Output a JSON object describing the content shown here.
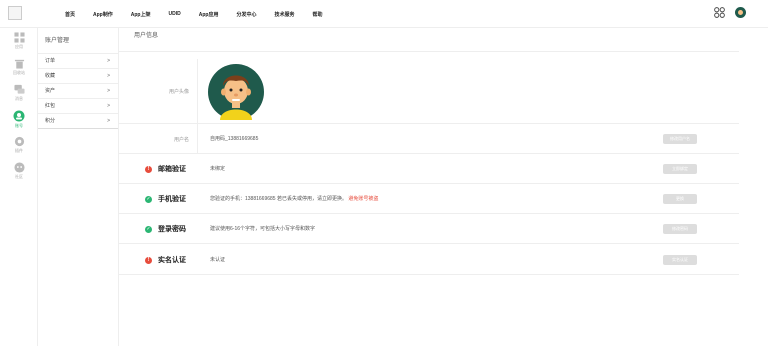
{
  "nav": {
    "items": [
      "首页",
      "App制作",
      "App上架",
      "UDID",
      "App应用",
      "分发中心",
      "技术服务",
      "帮助"
    ]
  },
  "rail": {
    "items": [
      {
        "label": "应用",
        "icon": "grid-icon"
      },
      {
        "label": "回收站",
        "icon": "trash-icon"
      },
      {
        "label": "消息",
        "icon": "message-icon"
      },
      {
        "label": "账号",
        "icon": "user-icon"
      },
      {
        "label": "插件",
        "icon": "settings-icon"
      },
      {
        "label": "社区",
        "icon": "community-icon"
      }
    ]
  },
  "menu": {
    "title": "账户管理",
    "items": [
      "订单",
      "收藏",
      "资产",
      "红包",
      "积分"
    ],
    "chevron": ">"
  },
  "main": {
    "title": "用户信息",
    "rows": {
      "avatar": {
        "label": "用户头像"
      },
      "username": {
        "label": "用户名",
        "value": "自用码_13881669685",
        "button": "修改用户名"
      },
      "email": {
        "label": "邮箱验证",
        "value": "未绑定",
        "button": "立即绑定",
        "status": "warn"
      },
      "phone": {
        "label": "手机验证",
        "value": "您验证的手机：13881669685 若已丢失或停用，请立即更换。",
        "link": "避免账号被盗",
        "button": "更换",
        "status": "ok"
      },
      "password": {
        "label": "登录密码",
        "value": "建议使用6-16个字符，可包括大小写字母和数字",
        "button": "修改密码",
        "status": "ok"
      },
      "realname": {
        "label": "实名认证",
        "value": "未认证",
        "button": "实名认证",
        "status": "warn"
      }
    }
  },
  "colors": {
    "accent": "#2bb673",
    "warn": "#e74c3c",
    "button": "#dddddd"
  }
}
